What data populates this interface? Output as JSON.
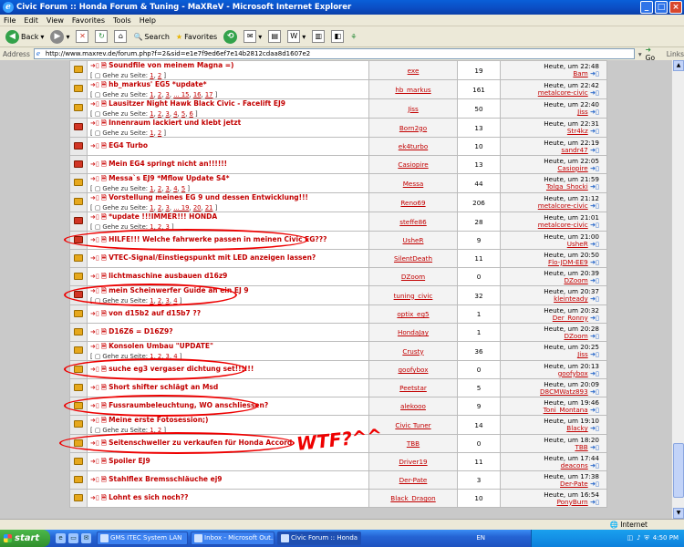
{
  "window": {
    "title": "Civic Forum :: Honda Forum & Tuning - MaXReV - Microsoft Internet Explorer"
  },
  "menu": [
    "File",
    "Edit",
    "View",
    "Favorites",
    "Tools",
    "Help"
  ],
  "toolbar": {
    "back": "Back",
    "search": "Search",
    "favorites": "Favorites"
  },
  "address": {
    "label": "Address",
    "url": "http://www.maxrev.de/forum.php?f=2&sid=e1e7f9ed6ef7e14b2812cdaa8d1607e2",
    "go": "Go",
    "links": "Links"
  },
  "goto_label": "Gehe zu Seite:",
  "topics": [
    {
      "title": "Soundfile von meinem Magna =)",
      "pages": "1, 2",
      "author": "exe",
      "replies": "19",
      "date": "Heute, um 22:48",
      "last_user": "Bam",
      "icon": "normal"
    },
    {
      "title": "hb_markus' EG5 *update*",
      "pages": "1, 2, 3, ... 15, 16, 17",
      "author": "hb_markus",
      "replies": "161",
      "date": "Heute, um 22:42",
      "last_user": "metalcore-civic",
      "icon": "normal"
    },
    {
      "title": "Lausitzer Night Hawk Black Civic - Facelift EJ9",
      "pages": "1, 2, 3, 4, 5, 6",
      "author": "Jiss",
      "replies": "50",
      "date": "Heute, um 22:40",
      "last_user": "Jiss",
      "icon": "normal"
    },
    {
      "title": "Innenraum lackiert und klebt jetzt",
      "pages": "1, 2",
      "author": "Born2go",
      "replies": "13",
      "date": "Heute, um 22:31",
      "last_user": "Str4kz",
      "icon": "hot"
    },
    {
      "title": "EG4 Turbo",
      "pages": "",
      "author": "ek4turbo",
      "replies": "10",
      "date": "Heute, um 22:19",
      "last_user": "sandr47",
      "icon": "hot"
    },
    {
      "title": "Mein EG4 springt nicht an!!!!!!",
      "pages": "",
      "author": "Casiopire",
      "replies": "13",
      "date": "Heute, um 22:05",
      "last_user": "Casiopire",
      "icon": "hot"
    },
    {
      "title": "Messa`s EJ9 *Mflow Update S4*",
      "pages": "1, 2, 3, 4, 5",
      "author": "Messa",
      "replies": "44",
      "date": "Heute, um 21:59",
      "last_user": "Tolga_Shocki",
      "icon": "normal"
    },
    {
      "title": "Vorstellung meines EG 9 und dessen Entwicklung!!!",
      "pages": "1, 2, 3, ... 19, 20, 21",
      "author": "Reno69",
      "replies": "206",
      "date": "Heute, um 21:12",
      "last_user": "metalcore-civic",
      "icon": "normal"
    },
    {
      "title": "*update !!!IMMER!!! HONDA",
      "pages": "1, 2, 3",
      "author": "steffe86",
      "replies": "28",
      "date": "Heute, um 21:01",
      "last_user": "metalcore-civic",
      "icon": "hot"
    },
    {
      "title": "HILFE!!! Welche fahrwerke passen in meinen Civic EG???",
      "pages": "",
      "author": "UsheR",
      "replies": "9",
      "date": "Heute, um 21:00",
      "last_user": "UsheR",
      "icon": "hot"
    },
    {
      "title": "VTEC-Signal/Einstiegspunkt mit LED anzeigen lassen?",
      "pages": "",
      "author": "SilentDeath",
      "replies": "11",
      "date": "Heute, um 20:50",
      "last_user": "Flo-JDM-EE9",
      "icon": "normal"
    },
    {
      "title": "lichtmaschine ausbauen d16z9",
      "pages": "",
      "author": "DZoom",
      "replies": "0",
      "date": "Heute, um 20:39",
      "last_user": "DZoom",
      "icon": "normal"
    },
    {
      "title": "mein Scheinwerfer Guide an ein EJ 9",
      "pages": "1, 2, 3, 4",
      "author": "tuning_civic",
      "replies": "32",
      "date": "Heute, um 20:37",
      "last_user": "kleinteady",
      "icon": "hot"
    },
    {
      "title": "von d15b2 auf d15b7 ??",
      "pages": "",
      "author": "optix_eg5",
      "replies": "1",
      "date": "Heute, um 20:32",
      "last_user": "Der_Ronny",
      "icon": "normal"
    },
    {
      "title": "D16Z6 = D16Z9?",
      "pages": "",
      "author": "HondaJay",
      "replies": "1",
      "date": "Heute, um 20:28",
      "last_user": "DZoom",
      "icon": "normal"
    },
    {
      "title": "Konsolen Umbau \"UPDATE\"",
      "pages": "1, 2, 3, 4",
      "author": "Crusty",
      "replies": "36",
      "date": "Heute, um 20:25",
      "last_user": "Jiss",
      "icon": "normal"
    },
    {
      "title": "suche eg3 vergaser dichtung set!!!!!!",
      "pages": "",
      "author": "goofybox",
      "replies": "0",
      "date": "Heute, um 20:13",
      "last_user": "goofybox",
      "icon": "normal"
    },
    {
      "title": "Short shifter schlägt an Msd",
      "pages": "",
      "author": "Peetstar",
      "replies": "5",
      "date": "Heute, um 20:09",
      "last_user": "D8CMWatz893",
      "icon": "normal"
    },
    {
      "title": "Fussraumbeleuchtung, WO anschliessen?",
      "pages": "",
      "author": "alekooo",
      "replies": "9",
      "date": "Heute, um 19:46",
      "last_user": "Toni_Montana",
      "icon": "normal"
    },
    {
      "title": "Meine erste Fotosession;)",
      "pages": "1, 2",
      "author": "Civic Tuner",
      "replies": "14",
      "date": "Heute, um 19:10",
      "last_user": "Blacky",
      "icon": "normal"
    },
    {
      "title": "Seitenschweller zu verkaufen für Honda Accord",
      "pages": "",
      "author": "TBB",
      "replies": "0",
      "date": "Heute, um 18:20",
      "last_user": "TBB",
      "icon": "normal"
    },
    {
      "title": "Spoiler EJ9",
      "pages": "",
      "author": "Driver19",
      "replies": "11",
      "date": "Heute, um 17:44",
      "last_user": "deacons",
      "icon": "normal"
    },
    {
      "title": "Stahlflex Bremsschläuche ej9",
      "pages": "",
      "author": "Der-Pate",
      "replies": "3",
      "date": "Heute, um 17:38",
      "last_user": "Der-Pate",
      "icon": "normal"
    },
    {
      "title": "Lohnt es sich noch??",
      "pages": "",
      "author": "Black_Dragon",
      "replies": "10",
      "date": "Heute, um 16:54",
      "last_user": "PonyBurn",
      "icon": "normal"
    }
  ],
  "annotation": "WTF?^^",
  "status": {
    "zone": "Internet"
  },
  "taskbar": {
    "start": "start",
    "tasks": [
      "GMS ITEC System LAN",
      "Inbox - Microsoft Out...",
      "Civic Forum :: Honda ..."
    ],
    "lang": "EN",
    "clock": "4:50 PM"
  }
}
